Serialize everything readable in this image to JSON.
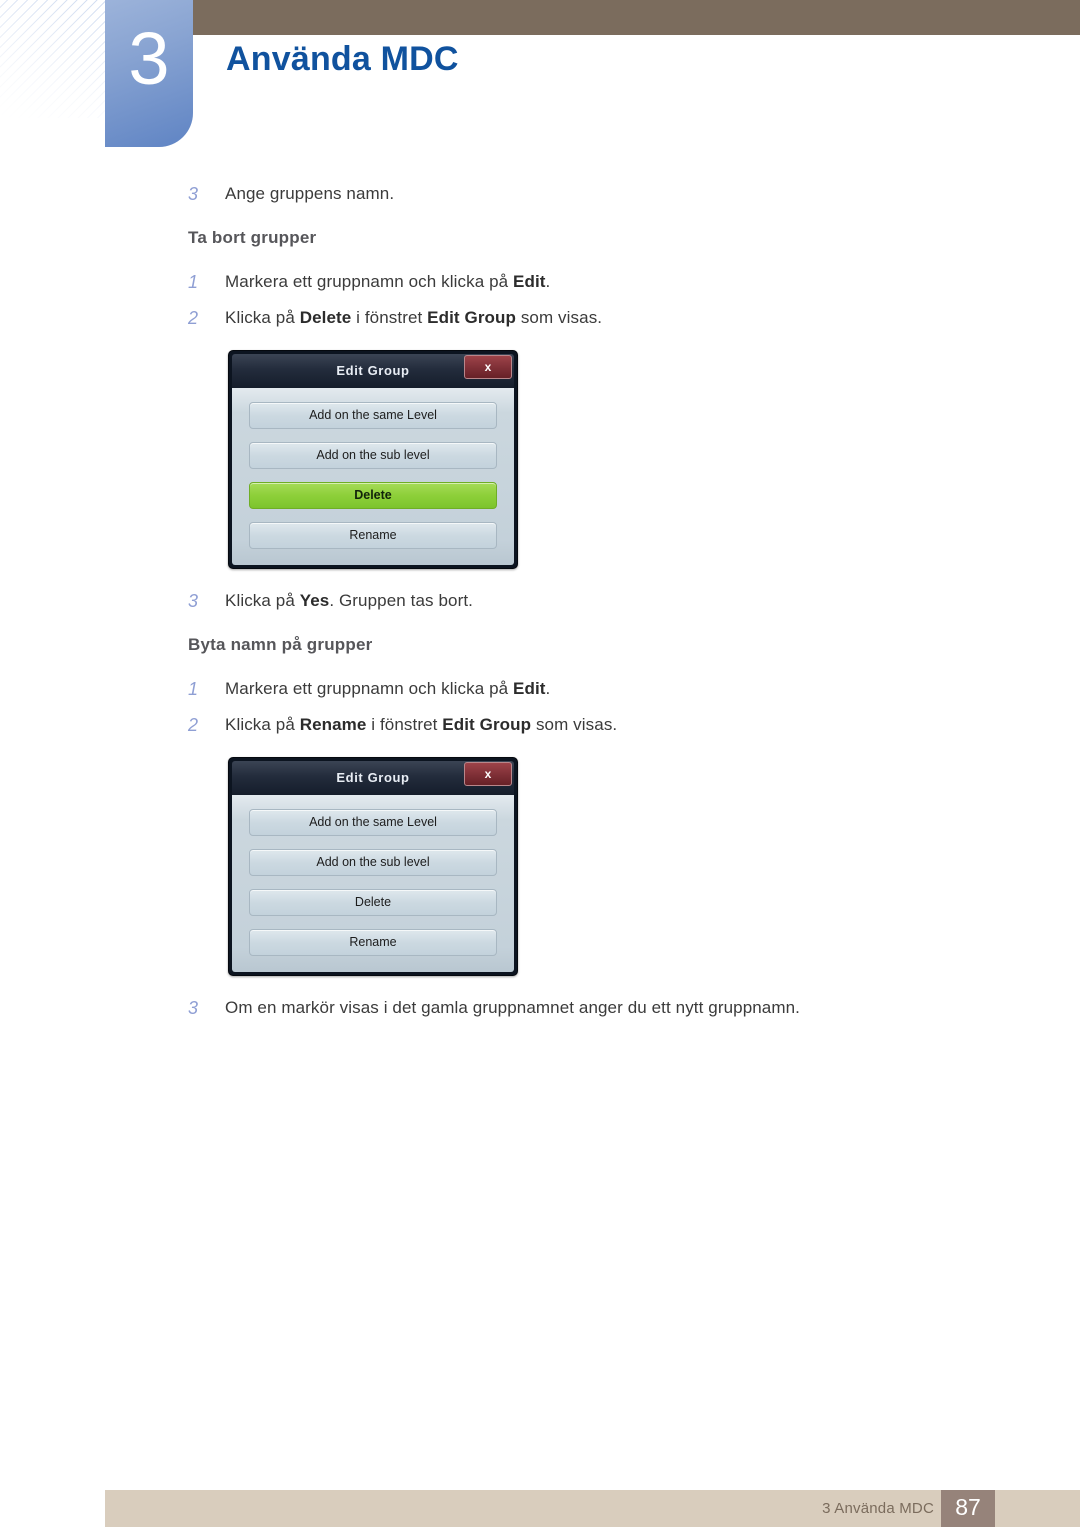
{
  "header": {
    "chapter_number": "3",
    "chapter_title": "Använda MDC",
    "brown_bar_color": "#7b6c5d",
    "badge_color": "#5f84c4",
    "title_color": "#10529e"
  },
  "content": {
    "step_a": {
      "num": "3",
      "text": "Ange gruppens namn."
    },
    "section_delete": {
      "heading": "Ta bort grupper",
      "steps": [
        {
          "num": "1",
          "parts": [
            {
              "text": "Markera ett gruppnamn och klicka på ",
              "bold": false
            },
            {
              "text": "Edit",
              "bold": true
            },
            {
              "text": ".",
              "bold": false
            }
          ]
        },
        {
          "num": "2",
          "parts": [
            {
              "text": "Klicka på ",
              "bold": false
            },
            {
              "text": "Delete",
              "bold": true
            },
            {
              "text": " i fönstret ",
              "bold": false
            },
            {
              "text": "Edit Group",
              "bold": true
            },
            {
              "text": " som visas.",
              "bold": false
            }
          ]
        },
        {
          "num": "3",
          "parts": [
            {
              "text": "Klicka på ",
              "bold": false
            },
            {
              "text": "Yes",
              "bold": true
            },
            {
              "text": ". Gruppen tas bort.",
              "bold": false
            }
          ]
        }
      ]
    },
    "section_rename": {
      "heading": "Byta namn på grupper",
      "steps": [
        {
          "num": "1",
          "parts": [
            {
              "text": "Markera ett gruppnamn och klicka på ",
              "bold": false
            },
            {
              "text": "Edit",
              "bold": true
            },
            {
              "text": ".",
              "bold": false
            }
          ]
        },
        {
          "num": "2",
          "parts": [
            {
              "text": "Klicka på ",
              "bold": false
            },
            {
              "text": "Rename",
              "bold": true
            },
            {
              "text": " i fönstret ",
              "bold": false
            },
            {
              "text": "Edit Group",
              "bold": true
            },
            {
              "text": " som visas.",
              "bold": false
            }
          ]
        },
        {
          "num": "3",
          "parts": [
            {
              "text": "Om en markör visas i det gamla gruppnamnet anger du ett nytt gruppnamn.",
              "bold": false
            }
          ]
        }
      ]
    }
  },
  "dialog_delete": {
    "title": "Edit Group",
    "close_label": "x",
    "buttons": [
      {
        "label": "Add on the same Level",
        "highlighted": false
      },
      {
        "label": "Add on the sub level",
        "highlighted": false
      },
      {
        "label": "Delete",
        "highlighted": true
      },
      {
        "label": "Rename",
        "highlighted": false
      }
    ],
    "highlight_color": "#8ed03a"
  },
  "dialog_rename": {
    "title": "Edit Group",
    "close_label": "x",
    "buttons": [
      {
        "label": "Add on the same Level",
        "highlighted": false
      },
      {
        "label": "Add on the sub level",
        "highlighted": false
      },
      {
        "label": "Delete",
        "highlighted": false
      },
      {
        "label": "Rename",
        "highlighted": false
      }
    ],
    "highlight_color": "#8ed03a"
  },
  "footer": {
    "text": "3 Använda MDC",
    "page_number": "87",
    "bar_color": "#d9cdbd",
    "page_box_color": "#96837a"
  }
}
